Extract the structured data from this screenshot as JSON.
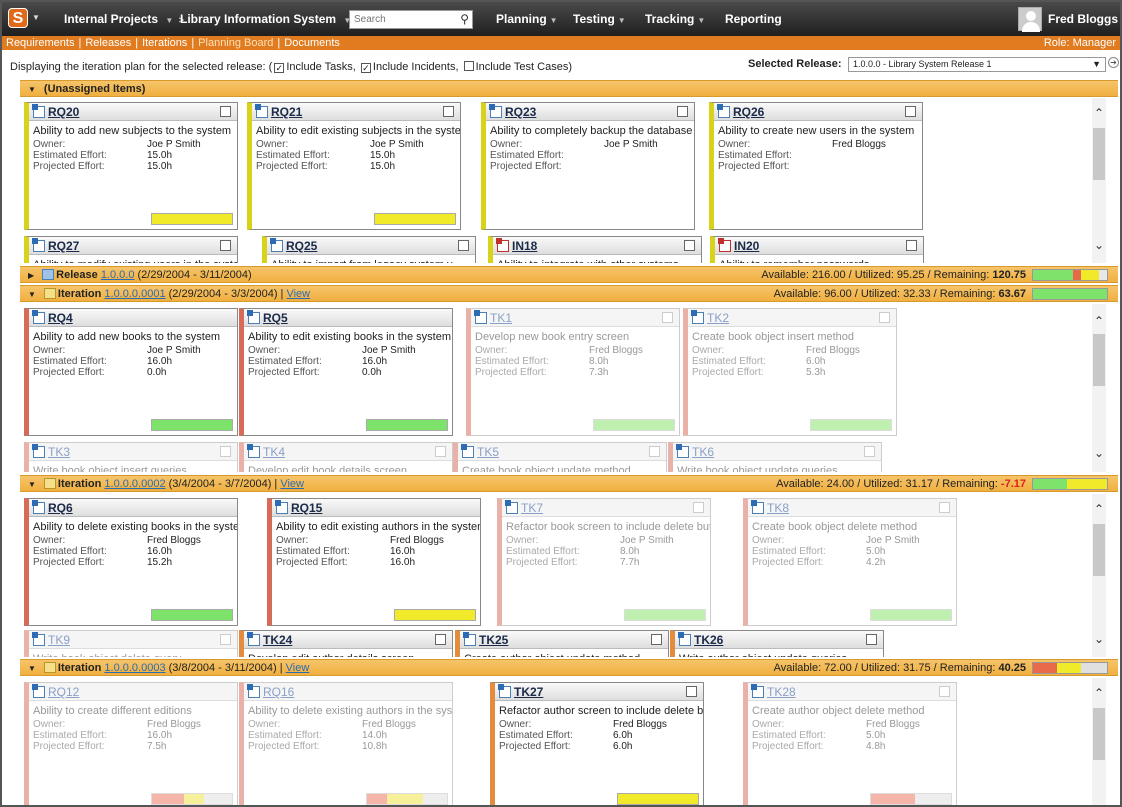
{
  "topbar": {
    "logo_letter": "S",
    "project": "Internal Projects",
    "product": "Library Information System",
    "search_placeholder": "Search",
    "nav": [
      "Planning",
      "Testing",
      "Tracking",
      "Reporting"
    ],
    "user": "Fred Bloggs"
  },
  "subtabs": [
    "Requirements",
    "Releases",
    "Iterations",
    "Planning Board",
    "Documents"
  ],
  "role": "Role: Manager",
  "options": {
    "lead": "Displaying the iteration plan for the selected release: (",
    "include_tasks": "Include Tasks,",
    "include_incidents": "Include Incidents,",
    "include_test_cases": "Include Test Cases)",
    "selected_release_label": "Selected Release:",
    "selected_release_value": "1.0.0.0 - Library System Release 1"
  },
  "colors": {
    "bar_green": "#7ee36a",
    "bar_yellow": "#f0ea2a",
    "bar_red": "#e86a4a",
    "bar_gray": "#e0e0e0"
  },
  "sections": {
    "unassigned": {
      "title": "(Unassigned Items)"
    },
    "release": {
      "label": "Release",
      "link": "1.0.0.0",
      "dates": "(2/29/2004 - 3/11/2004)",
      "cap_prefix": "Available: 216.00 / Utilized: 95.25 / Remaining:",
      "remaining": "120.75"
    },
    "iter1": {
      "label": "Iteration",
      "link": "1.0.0.0.0001",
      "dates": "(2/29/2004 - 3/3/2004) |",
      "view": "View",
      "cap_prefix": "Available: 96.00 / Utilized: 32.33 / Remaining:",
      "remaining": "63.67"
    },
    "iter2": {
      "label": "Iteration",
      "link": "1.0.0.0.0002",
      "dates": "(3/4/2004 - 3/7/2004) |",
      "view": "View",
      "cap_prefix": "Available: 24.00 / Utilized: 31.17 / Remaining:",
      "remaining": "-7.17"
    },
    "iter3": {
      "label": "Iteration",
      "link": "1.0.0.0.0003",
      "dates": "(3/8/2004 - 3/11/2004) |",
      "view": "View",
      "cap_prefix": "Available: 72.00 / Utilized: 31.75 / Remaining:",
      "remaining": "40.25"
    }
  },
  "labels": {
    "owner": "Owner:",
    "est": "Estimated Effort:",
    "proj": "Projected Effort:"
  },
  "cards": {
    "RQ20": {
      "code": "RQ20",
      "title": "Ability to add new subjects to the system",
      "owner": "Joe P Smith",
      "est": "15.0h",
      "proj": "15.0h"
    },
    "RQ21": {
      "code": "RQ21",
      "title": "Ability to edit existing subjects in the system",
      "owner": "Joe P Smith",
      "est": "15.0h",
      "proj": "15.0h"
    },
    "RQ23": {
      "code": "RQ23",
      "title": "Ability to completely backup the database",
      "owner": "Joe P Smith",
      "est": "",
      "proj": ""
    },
    "RQ26": {
      "code": "RQ26",
      "title": "Ability to create new users in the system",
      "owner": "Fred Bloggs",
      "est": "",
      "proj": ""
    },
    "RQ27": {
      "code": "RQ27",
      "title": "Ability to modify existing users in the system"
    },
    "RQ25": {
      "code": "RQ25",
      "title": "Ability to import from legacy system v..."
    },
    "IN18": {
      "code": "IN18",
      "title": "Ability to integrate with other systems"
    },
    "IN20": {
      "code": "IN20",
      "title": "Ability to remember passwords"
    },
    "RQ4": {
      "code": "RQ4",
      "title": "Ability to add new books to the system",
      "owner": "Joe P Smith",
      "est": "16.0h",
      "proj": "0.0h"
    },
    "RQ5": {
      "code": "RQ5",
      "title": "Ability to edit existing books in the system",
      "owner": "Joe P Smith",
      "est": "16.0h",
      "proj": "0.0h"
    },
    "TK1": {
      "code": "TK1",
      "title": "Develop new book entry screen",
      "owner": "Fred Bloggs",
      "est": "8.0h",
      "proj": "7.3h"
    },
    "TK2": {
      "code": "TK2",
      "title": "Create book object insert method",
      "owner": "Fred Bloggs",
      "est": "6.0h",
      "proj": "5.3h"
    },
    "TK3": {
      "code": "TK3",
      "title": "Write book object insert queries"
    },
    "TK4": {
      "code": "TK4",
      "title": "Develop edit book details screen"
    },
    "TK5": {
      "code": "TK5",
      "title": "Create book object update method"
    },
    "TK6": {
      "code": "TK6",
      "title": "Write book object update queries"
    },
    "RQ6": {
      "code": "RQ6",
      "title": "Ability to delete existing books in the system",
      "owner": "Fred Bloggs",
      "est": "16.0h",
      "proj": "15.2h"
    },
    "RQ15": {
      "code": "RQ15",
      "title": "Ability to edit existing authors in the system",
      "owner": "Fred Bloggs",
      "est": "16.0h",
      "proj": "16.0h"
    },
    "TK7": {
      "code": "TK7",
      "title": "Refactor book screen to include delete button",
      "owner": "Joe P Smith",
      "est": "8.0h",
      "proj": "7.7h"
    },
    "TK8": {
      "code": "TK8",
      "title": "Create book object delete method",
      "owner": "Joe P Smith",
      "est": "5.0h",
      "proj": "4.2h"
    },
    "TK9": {
      "code": "TK9",
      "title": "Write book object delete query"
    },
    "TK24": {
      "code": "TK24",
      "title": "Develop edit author details screen"
    },
    "TK25": {
      "code": "TK25",
      "title": "Create author object update method"
    },
    "TK26": {
      "code": "TK26",
      "title": "Write author object update queries"
    },
    "RQ12": {
      "code": "RQ12",
      "title": "Ability to create different editions",
      "owner": "Fred Bloggs",
      "est": "16.0h",
      "proj": "7.5h"
    },
    "RQ16": {
      "code": "RQ16",
      "title": "Ability to delete existing authors in the system",
      "owner": "Fred Bloggs",
      "est": "14.0h",
      "proj": "10.8h"
    },
    "TK27": {
      "code": "TK27",
      "title": "Refactor author screen to include delete button",
      "owner": "Fred Bloggs",
      "est": "6.0h",
      "proj": "6.0h"
    },
    "TK28": {
      "code": "TK28",
      "title": "Create author object delete method",
      "owner": "Fred Bloggs",
      "est": "5.0h",
      "proj": "4.8h"
    }
  }
}
